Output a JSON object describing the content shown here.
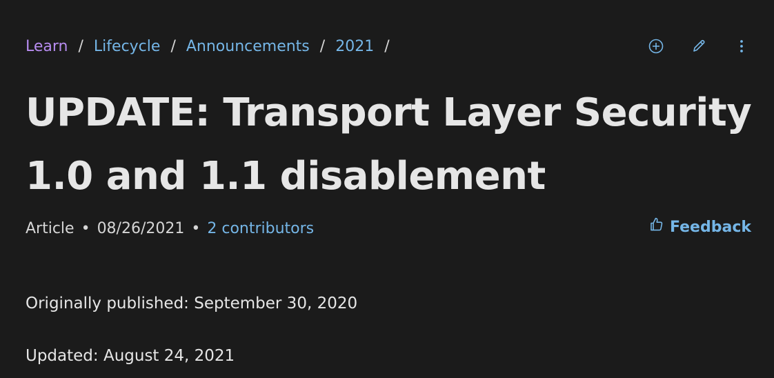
{
  "breadcrumb": {
    "items": [
      {
        "label": "Learn"
      },
      {
        "label": "Lifecycle"
      },
      {
        "label": "Announcements"
      },
      {
        "label": "2021"
      }
    ],
    "separator": "/"
  },
  "actions": {
    "icons": [
      "add-circle-icon",
      "pencil-icon",
      "more-vertical-icon"
    ]
  },
  "article": {
    "title": "UPDATE: Transport Layer Security 1.0 and 1.1 disablement",
    "type": "Article",
    "date": "08/26/2021",
    "bullet": "•",
    "contributors": "2 contributors",
    "feedback_label": "Feedback",
    "paragraphs": {
      "originally_published": "Originally published: September 30, 2020",
      "updated": "Updated: August 24, 2021"
    }
  },
  "colors": {
    "background": "#1b1b1b",
    "text": "#e6e6e6",
    "link": "#75b6e7",
    "first_crumb": "#b78cf0"
  }
}
